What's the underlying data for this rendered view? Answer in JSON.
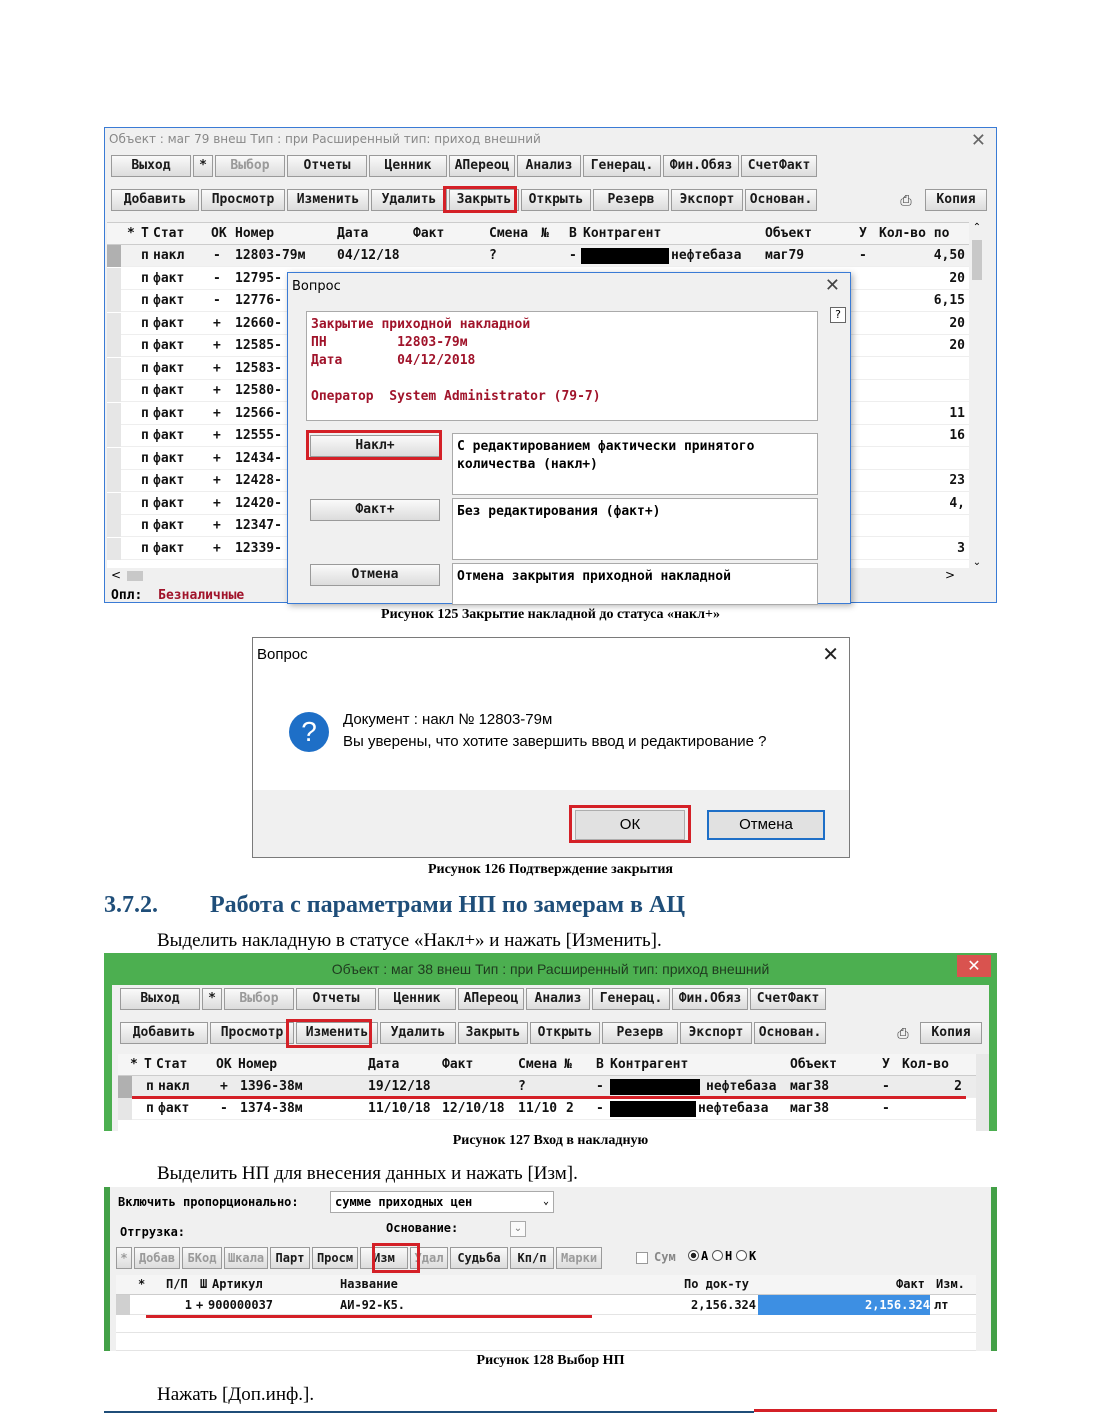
{
  "fig125": {
    "title": "Объект : маг 79  внеш   Тип : при Расширенный тип: приход внешний",
    "toolbar1": [
      "Выход",
      "*",
      "Выбор",
      "Отчеты",
      "Ценник",
      "АПереоц",
      "Анализ",
      "Генерац.",
      "Фин.Обяз",
      "СчетФакт"
    ],
    "toolbar2": [
      "Добавить",
      "Просмотр",
      "Изменить",
      "Удалить",
      "Закрыть",
      "Открыть",
      "Резерв",
      "Экспорт",
      "Основан.",
      "Копия"
    ],
    "headers": [
      "*",
      "Т",
      "Стат",
      "ОК",
      "Номер",
      "Дата",
      "Факт",
      "Смена",
      "№",
      "В",
      "Контрагент",
      "Объект",
      "У",
      "Кол-во по"
    ],
    "rows": [
      {
        "t": "п",
        "stat": "накл",
        "ok": "-",
        "num": "12803-79м",
        "date": "04/12/18",
        "fact": "",
        "smena": "?",
        "v": "-",
        "kontr": "нефтебаза",
        "obj": "маг79",
        "u": "-",
        "qty": "4,50"
      },
      {
        "t": "п",
        "stat": "факт",
        "ok": "-",
        "num": "12795-",
        "qty": "20"
      },
      {
        "t": "п",
        "stat": "факт",
        "ok": "-",
        "num": "12776-",
        "qty": "6,15"
      },
      {
        "t": "п",
        "stat": "факт",
        "ok": "+",
        "num": "12660-",
        "qty": "20"
      },
      {
        "t": "п",
        "stat": "факт",
        "ok": "+",
        "num": "12585-",
        "qty": "20"
      },
      {
        "t": "п",
        "stat": "факт",
        "ok": "+",
        "num": "12583-",
        "qty": ""
      },
      {
        "t": "п",
        "stat": "факт",
        "ok": "+",
        "num": "12580-",
        "qty": ""
      },
      {
        "t": "п",
        "stat": "факт",
        "ok": "+",
        "num": "12566-",
        "qty": "11"
      },
      {
        "t": "п",
        "stat": "факт",
        "ok": "+",
        "num": "12555-",
        "qty": "16"
      },
      {
        "t": "п",
        "stat": "факт",
        "ok": "+",
        "num": "12434-",
        "qty": ""
      },
      {
        "t": "п",
        "stat": "факт",
        "ok": "+",
        "num": "12428-",
        "qty": "23"
      },
      {
        "t": "п",
        "stat": "факт",
        "ok": "+",
        "num": "12420-",
        "qty": "4,"
      },
      {
        "t": "п",
        "stat": "факт",
        "ok": "+",
        "num": "12347-",
        "qty": ""
      },
      {
        "t": "п",
        "stat": "факт",
        "ok": "+",
        "num": "12339-",
        "qty": "3"
      }
    ],
    "status_label": "Опл:",
    "status_value": "Безналичные",
    "dialog": {
      "title": "Вопрос",
      "info_lines": [
        "Закрытие приходной накладной",
        "ПН         12803-79м",
        "Дата       04/12/2018",
        "",
        "Оператор  System Administrator (79-7)"
      ],
      "btn1": "Накл+",
      "desc1": "С редактированием фактически принятого количества (накл+)",
      "btn2": "Факт+",
      "desc2": "Без редактирования (факт+)",
      "btn3": "Отмена",
      "desc3": "Отмена закрытия приходной накладной"
    },
    "caption": "Рисунок 125 Закрытие накладной до статуса «накл+»"
  },
  "fig126": {
    "title": "Вопрос",
    "line1": "Документ : накл № 12803-79м",
    "line2": "Вы уверены, что хотите завершить ввод и редактирование ?",
    "ok": "ОК",
    "cancel": "Отмена",
    "caption": "Рисунок 126 Подтверждение закрытия"
  },
  "section": {
    "number": "3.7.2.",
    "title": "Работа с параметрами НП по замерам в АЦ",
    "para1": "Выделить накладную в статусе «Накл+» и нажать [Изменить]."
  },
  "fig127": {
    "title": "Объект : маг 38  внеш   Тип : при Расширенный тип: приход внешний",
    "toolbar1": [
      "Выход",
      "*",
      "Выбор",
      "Отчеты",
      "Ценник",
      "АПереоц",
      "Анализ",
      "Генерац.",
      "Фин.Обяз",
      "СчетФакт"
    ],
    "toolbar2": [
      "Добавить",
      "Просмотр",
      "Изменить",
      "Удалить",
      "Закрыть",
      "Открыть",
      "Резерв",
      "Экспорт",
      "Основан.",
      "Копия"
    ],
    "headers": [
      "*",
      "Т",
      "Стат",
      "ОК",
      "Номер",
      "Дата",
      "Факт",
      "Смена",
      "№",
      "В",
      "Контрагент",
      "Объект",
      "У",
      "Кол-во"
    ],
    "rows": [
      {
        "t": "п",
        "stat": "накл",
        "ok": "+",
        "num": "1396-38м",
        "date": "19/12/18",
        "fact": "",
        "smena": "?",
        "n": "",
        "v": "-",
        "kontr": "нефтебаза",
        "obj": "маг38",
        "u": "-",
        "qty": "2"
      },
      {
        "t": "п",
        "stat": "факт",
        "ok": "-",
        "num": "1374-38м",
        "date": "11/10/18",
        "fact": "12/10/18",
        "smena": "11/10",
        "n": "2",
        "v": "-",
        "kontr": "нефтебаза",
        "obj": "маг38",
        "u": "-",
        "qty": ""
      }
    ],
    "caption": "Рисунок 127 Вход в накладную"
  },
  "para2": "Выделить НП для внесения данных и нажать [Изм].",
  "fig128": {
    "include_label": "Включить пропорционально:",
    "include_value": "сумме приходных цен",
    "shipment_label": "Отгрузка:",
    "basis_label": "Основание:",
    "toolbar": [
      "*",
      "Добав",
      "БКод",
      "Шкала",
      "Парт",
      "Просм",
      "Изм",
      "Удал",
      "Судьба",
      "Кп/п",
      "Марки"
    ],
    "sum_label": "Сум",
    "radios": [
      "А",
      "Н",
      "К"
    ],
    "headers": [
      "*",
      "П/П",
      "Ш",
      "Артикул",
      "Название",
      "По док-ту",
      "Факт",
      "Изм."
    ],
    "row": {
      "pp": "1",
      "sh": "+",
      "art": "900000037",
      "name": "АИ-92-К5.",
      "doc": "2,156.324",
      "fact": "2,156.324",
      "unit": "лт"
    },
    "caption": "Рисунок 128 Выбор НП"
  },
  "para3": "Нажать [Доп.инф.].",
  "colors": {
    "accent_red": "#d42027",
    "heading_blue": "#1f4e79",
    "dialog_red_text": "#a0132a",
    "green_frame": "#43a047",
    "selection_blue": "#3d8fe3"
  },
  "icons": [
    "close-icon",
    "question-icon",
    "filter-icon",
    "print-icon",
    "help-icon",
    "scroll-arrow-icon"
  ]
}
